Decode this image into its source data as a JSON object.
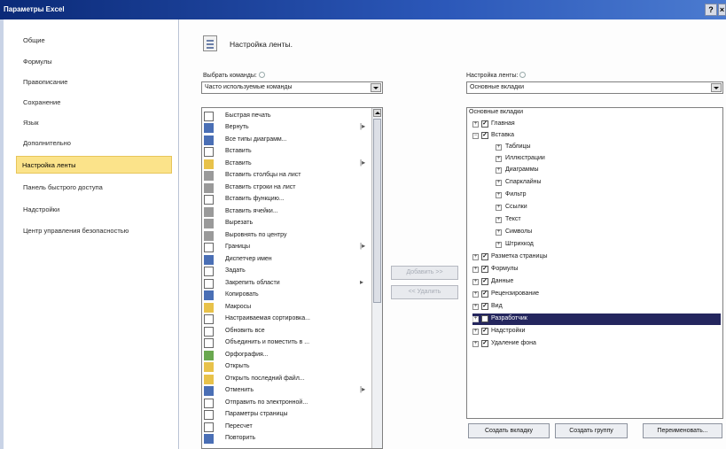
{
  "window": {
    "title": "Параметры Excel",
    "help_label": "?",
    "close_label": "×"
  },
  "sidebar": {
    "items": [
      {
        "label": "Общие"
      },
      {
        "label": "Формулы"
      },
      {
        "label": "Правописание"
      },
      {
        "label": "Сохранение"
      },
      {
        "label": "Язык"
      },
      {
        "label": "Дополнительно"
      },
      {
        "label": "Настройка ленты",
        "selected": true
      },
      {
        "label": "Панель быстрого доступа"
      },
      {
        "label": "Надстройки"
      },
      {
        "label": "Центр управления безопасностью"
      }
    ]
  },
  "main": {
    "heading": "Настройка ленты.",
    "choose_commands": {
      "label": "Выбрать команды:",
      "value": "Часто используемые команды"
    },
    "customize_ribbon": {
      "label": "Настройка ленты:",
      "value": "Основные вкладки"
    },
    "commands": [
      {
        "label": "Быстрая печать",
        "icon": "quick-print-icon",
        "sub": false
      },
      {
        "label": "Вернуть",
        "icon": "redo-icon",
        "sub": true
      },
      {
        "label": "Все типы диаграмм...",
        "icon": "chart-icon",
        "sub": false
      },
      {
        "label": "Вставить",
        "icon": "insert-icon",
        "sub": false
      },
      {
        "label": "Вставить",
        "icon": "paste-icon",
        "sub": true
      },
      {
        "label": "Вставить столбцы на лист",
        "icon": "insert-columns-icon",
        "sub": false
      },
      {
        "label": "Вставить строки на лист",
        "icon": "insert-rows-icon",
        "sub": false
      },
      {
        "label": "Вставить функцию...",
        "icon": "function-icon",
        "sub": false
      },
      {
        "label": "Вставить ячейки...",
        "icon": "insert-cells-icon",
        "sub": false
      },
      {
        "label": "Вырезать",
        "icon": "cut-icon",
        "sub": false
      },
      {
        "label": "Выровнять по центру",
        "icon": "align-center-icon",
        "sub": false
      },
      {
        "label": "Границы",
        "icon": "borders-icon",
        "sub": true
      },
      {
        "label": "Диспетчер имен",
        "icon": "name-manager-icon",
        "sub": false
      },
      {
        "label": "Задать",
        "icon": "set-icon",
        "sub": false
      },
      {
        "label": "Закрепить области",
        "icon": "freeze-panes-icon",
        "sub": true
      },
      {
        "label": "Копировать",
        "icon": "copy-icon",
        "sub": false
      },
      {
        "label": "Макросы",
        "icon": "macros-icon",
        "sub": false
      },
      {
        "label": "Настраиваемая сортировка...",
        "icon": "sort-icon",
        "sub": false
      },
      {
        "label": "Обновить все",
        "icon": "refresh-icon",
        "sub": false
      },
      {
        "label": "Объединить и поместить в ...",
        "icon": "merge-icon",
        "sub": false
      },
      {
        "label": "Орфография...",
        "icon": "spelling-icon",
        "sub": false
      },
      {
        "label": "Открыть",
        "icon": "open-icon",
        "sub": false
      },
      {
        "label": "Открыть последний файл...",
        "icon": "recent-file-icon",
        "sub": false
      },
      {
        "label": "Отменить",
        "icon": "undo-icon",
        "sub": true
      },
      {
        "label": "Отправить по электронной...",
        "icon": "email-icon",
        "sub": false
      },
      {
        "label": "Параметры страницы",
        "icon": "page-setup-icon",
        "sub": false
      },
      {
        "label": "Пересчет",
        "icon": "recalc-icon",
        "sub": false
      },
      {
        "label": "Повторить",
        "icon": "repeat-icon",
        "sub": false
      }
    ],
    "add_button": "Добавить >>",
    "remove_button": "<< Удалить",
    "tree": {
      "root": "Основные вкладки",
      "nodes": [
        {
          "label": "Главная",
          "level": 0,
          "expander": "+",
          "checked": true
        },
        {
          "label": "Вставка",
          "level": 0,
          "expander": "−",
          "checked": true
        },
        {
          "label": "Таблицы",
          "level": 1,
          "expander": "+"
        },
        {
          "label": "Иллюстрации",
          "level": 1,
          "expander": "+"
        },
        {
          "label": "Диаграммы",
          "level": 1,
          "expander": "+"
        },
        {
          "label": "Спарклайны",
          "level": 1,
          "expander": "+"
        },
        {
          "label": "Фильтр",
          "level": 1,
          "expander": "+"
        },
        {
          "label": "Ссылки",
          "level": 1,
          "expander": "+"
        },
        {
          "label": "Текст",
          "level": 1,
          "expander": "+"
        },
        {
          "label": "Символы",
          "level": 1,
          "expander": "+"
        },
        {
          "label": "Штрихкод",
          "level": 1,
          "expander": "+"
        },
        {
          "label": "Разметка страницы",
          "level": 0,
          "expander": "+",
          "checked": true
        },
        {
          "label": "Формулы",
          "level": 0,
          "expander": "+",
          "checked": true
        },
        {
          "label": "Данные",
          "level": 0,
          "expander": "+",
          "checked": true
        },
        {
          "label": "Рецензирование",
          "level": 0,
          "expander": "+",
          "checked": true
        },
        {
          "label": "Вид",
          "level": 0,
          "expander": "+",
          "checked": true
        },
        {
          "label": "Разработчик",
          "level": 0,
          "expander": "+",
          "checked": false,
          "highlighted": true
        },
        {
          "label": "Надстройки",
          "level": 0,
          "expander": "+",
          "checked": true
        },
        {
          "label": "Удаление фона",
          "level": 0,
          "expander": "+",
          "checked": true
        }
      ]
    },
    "bottom_buttons": [
      {
        "label": "Создать вкладку"
      },
      {
        "label": "Создать группу"
      },
      {
        "label": "Переименовать..."
      }
    ]
  },
  "colors": {
    "selection_yellow": "#fbe38a",
    "tree_highlight": "#24265e",
    "title_blue": "#0b2a78"
  }
}
